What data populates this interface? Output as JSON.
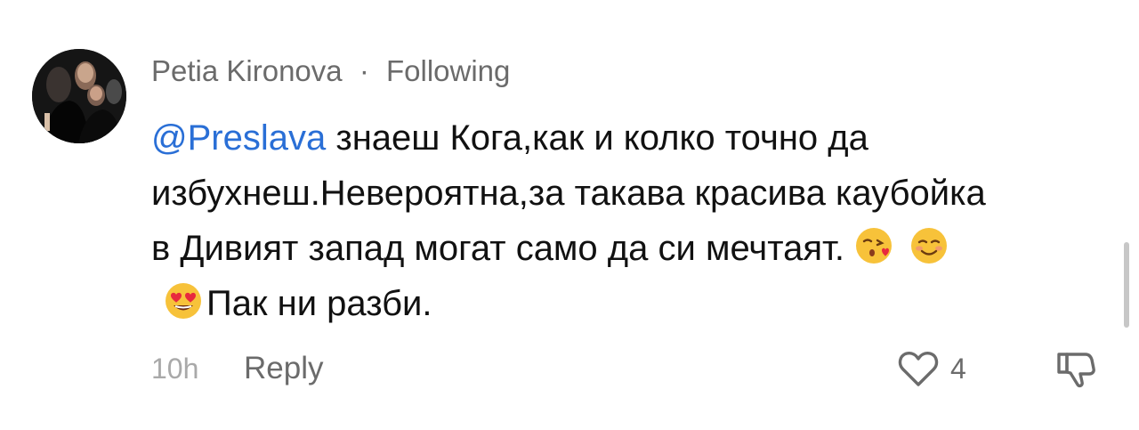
{
  "comment": {
    "author": "Petia Kironova",
    "separator": "·",
    "relation": "Following",
    "mention": "@Preslava",
    "text_part1": " знаеш Кога,как и колко точно да избухнеш.Невероятна,за такава красива каубойка в Дивият запад могат само да си мечтаят.",
    "emojis": [
      "kissing-heart-emoji",
      "smiling-blush-emoji",
      "heart-eyes-emoji"
    ],
    "text_part2": "Пак ни разби.",
    "time": "10h",
    "reply_label": "Reply",
    "like_count": "4"
  },
  "colors": {
    "mention": "#2a6fd6",
    "text": "#111111",
    "secondary": "#6b6b6b",
    "time": "#a9a9a9"
  },
  "icons": {
    "like": "heart-outline-icon",
    "dislike": "thumbs-down-outline-icon"
  }
}
